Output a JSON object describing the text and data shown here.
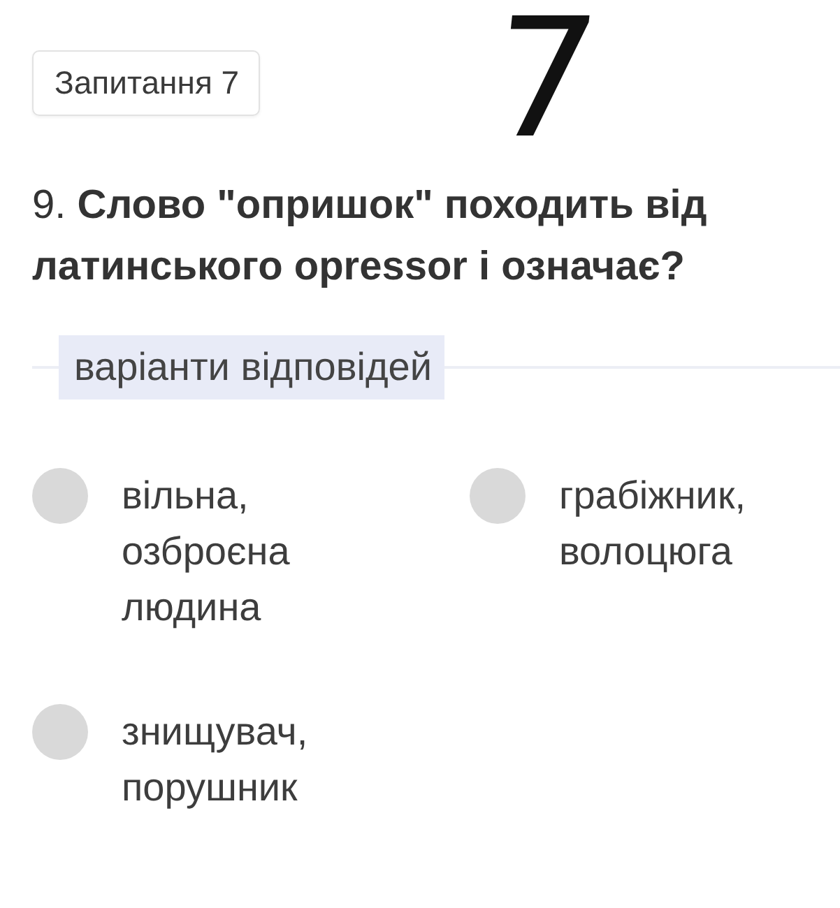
{
  "question_badge": "Запитання 7",
  "handwritten_note": "7",
  "question": "9. **Слово \"опришок\" походить від латинського opressor і означає?**",
  "answers_heading": "варіанти відповідей",
  "options": [
    {
      "label": "вільна, озброєна людина",
      "selected": false
    },
    {
      "label": "грабіжник, волоцюга",
      "selected": false
    },
    {
      "label": "знищувач, порушник",
      "selected": false
    }
  ]
}
